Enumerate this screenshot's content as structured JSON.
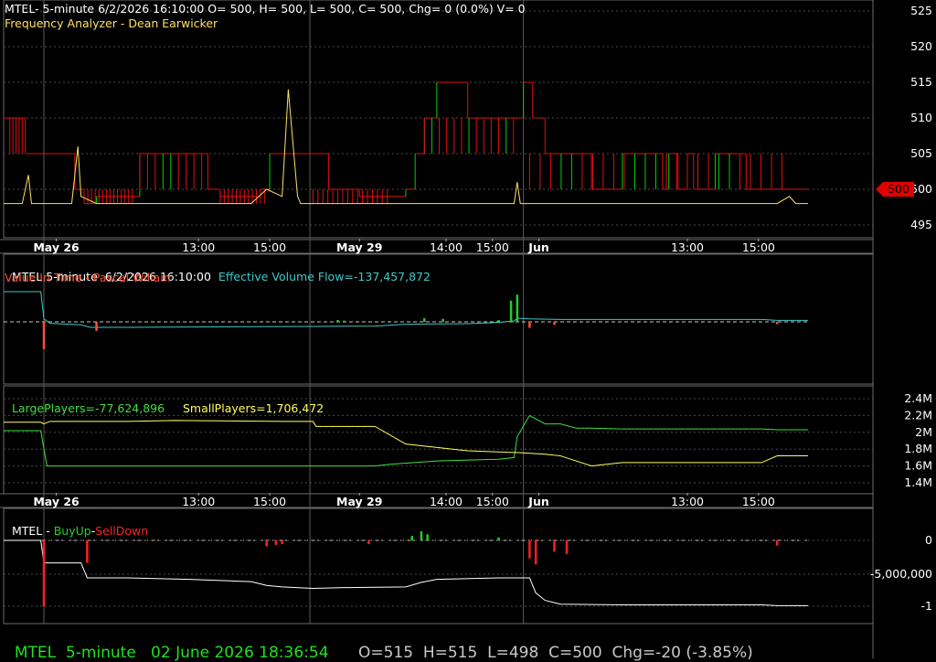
{
  "colors": {
    "bg": "#000000",
    "grid": "#4a4a4a",
    "axis_text": "#ffffff",
    "price_up": "#00d000",
    "price_down": "#e01010",
    "freq": "#ffe060",
    "evf": "#40c8c8",
    "vit": "#ff5030",
    "large": "#40e040",
    "small": "#ffff60",
    "buyup": "#20d020",
    "selldown": "#ff2020",
    "sum_line": "#ffffff",
    "status_symbol": "#20e020",
    "status_ohlc": "#c8c8c8",
    "marker_bg": "#e00000"
  },
  "panel1": {
    "header1": "MTEL- 5-minute 6/2/2026 16:10:00 O= 500, H= 500, L= 500, C= 500, Chg= 0 (0.0%) V= 0",
    "header2": "Frequency Analyzer - Dean Earwicker",
    "yticks": [
      "525",
      "520",
      "515",
      "510",
      "505",
      "500",
      "495"
    ],
    "last_price_marker": "500"
  },
  "panel2": {
    "header_symbol": "MTEL 5-minute  6/2/2026 16:10:00",
    "header_evf": "Effective Volume Flow=-137,457,872",
    "header_vit": "Value In Time - Pascal Willain"
  },
  "panel3": {
    "header_large": "LargePlayers=-77,624,896",
    "header_small": "SmallPlayers=1,706,472",
    "yticks": [
      "2.4M",
      "2.2M",
      "2M",
      "1.8M",
      "1.6M",
      "1.4M"
    ]
  },
  "panel4": {
    "header_symbol": "MTEL - ",
    "header_buy": "BuyUp",
    "header_dash": "-",
    "header_sell": "SellDown",
    "yticks": [
      "0",
      "-5,000,000",
      "-1"
    ]
  },
  "xaxis": {
    "labels": [
      "May 26",
      "13:00",
      "15:00",
      "May 29",
      "14:00",
      "15:00",
      "Jun",
      "13:00",
      "15:00"
    ]
  },
  "status": {
    "symbol": "MTEL",
    "interval": "5-minute",
    "datetime": "02 June 2026 18:36:54",
    "open": "O=515",
    "high": "H=515",
    "low": "L=498",
    "close": "C=500",
    "change": "Chg=-20 (-3.85%)"
  },
  "chart_data": [
    {
      "type": "line",
      "title": "MTEL- 5-minute 6/2/2026 16:10:00 O= 500, H= 500, L= 500, C= 500, Chg= 0 (0.0%) V= 0",
      "ylim": [
        493,
        526
      ],
      "x_labels": [
        "May 26",
        "13:00",
        "15:00",
        "May 29",
        "14:00",
        "15:00",
        "Jun",
        "13:00",
        "15:00"
      ],
      "series": [
        {
          "name": "",
          "x": [
            0,
            6,
            7,
            20,
            23,
            26,
            30,
            42,
            44,
            50,
            63,
            66,
            70,
            80,
            83,
            86,
            90,
            100,
            105,
            115,
            125,
            130,
            133,
            136,
            140,
            150,
            160,
            168,
            171,
            175,
            180,
            190,
            200,
            210,
            213,
            215,
            218,
            221,
            223,
            230,
            240,
            260
          ],
          "values": [
            510,
            510,
            505,
            505,
            500,
            498,
            499,
            499,
            505,
            505,
            505,
            500,
            499,
            499,
            500,
            505,
            505,
            505,
            500,
            499,
            499,
            500,
            505,
            510,
            515,
            510,
            510,
            515,
            510,
            505,
            505,
            500,
            505,
            505,
            500,
            505,
            500,
            505,
            500,
            505,
            500,
            500
          ]
        },
        {
          "name": "Frequency Analyzer",
          "x": [
            0,
            6,
            8,
            9,
            10,
            15,
            22,
            24,
            25,
            30,
            50,
            70,
            75,
            80,
            85,
            90,
            92,
            95,
            96,
            97,
            98,
            100,
            125,
            150,
            165,
            166,
            167,
            170,
            180,
            200,
            220,
            250,
            254,
            256,
            260
          ],
          "values": [
            498,
            498,
            502,
            498,
            498,
            498,
            498,
            506,
            499,
            498,
            498,
            498,
            498,
            498,
            500,
            499,
            514,
            499,
            498,
            498,
            498,
            498,
            498,
            498,
            498,
            501,
            498,
            498,
            498,
            498,
            498,
            498,
            499,
            498,
            498
          ]
        }
      ]
    },
    {
      "type": "line",
      "title": "Effective Volume Flow=-137,457,872",
      "series": [
        {
          "name": "Effective Volume Flow",
          "x": [
            0,
            12,
            13,
            15,
            25,
            28,
            40,
            60,
            80,
            100,
            120,
            125,
            130,
            140,
            150,
            160,
            165,
            166,
            170,
            180,
            200,
            220,
            245,
            250,
            260
          ],
          "values": [
            10,
            10,
            1,
            -0.5,
            -1,
            -1.8,
            -1.8,
            -1.7,
            -1.6,
            -1.5,
            -1.4,
            -1.1,
            -0.8,
            -0.7,
            -0.6,
            -0.2,
            0.3,
            1.2,
            1.0,
            0.8,
            0.8,
            0.8,
            0.8,
            0.5,
            0.5
          ]
        }
      ]
    },
    {
      "type": "line",
      "title": "LargePlayers / SmallPlayers",
      "ylim": [
        1.3,
        2.5
      ],
      "series": [
        {
          "name": "LargePlayers",
          "x": [
            0,
            12,
            13,
            14,
            50,
            90,
            110,
            120,
            125,
            140,
            160,
            165,
            166,
            170,
            175,
            180,
            185,
            190,
            200,
            220,
            245,
            250,
            260
          ],
          "values": [
            2.02,
            2.02,
            1.8,
            1.6,
            1.6,
            1.6,
            1.6,
            1.6,
            1.62,
            1.66,
            1.68,
            1.7,
            1.95,
            2.2,
            2.1,
            2.1,
            2.05,
            2.05,
            2.04,
            2.04,
            2.04,
            2.03,
            2.03
          ]
        },
        {
          "name": "SmallPlayers",
          "x": [
            0,
            12,
            13,
            15,
            40,
            55,
            90,
            100,
            101,
            120,
            130,
            150,
            165,
            166,
            175,
            180,
            185,
            190,
            200,
            220,
            245,
            250,
            260
          ],
          "values": [
            2.12,
            2.12,
            2.1,
            2.13,
            2.13,
            2.14,
            2.13,
            2.13,
            2.07,
            2.07,
            1.86,
            1.78,
            1.76,
            1.76,
            1.74,
            1.72,
            1.66,
            1.6,
            1.64,
            1.64,
            1.64,
            1.72,
            1.72
          ]
        }
      ]
    },
    {
      "type": "line",
      "title": "MTEL - BuyUp-SellDown",
      "series": [
        {
          "name": "BuyUp-SellDown",
          "x": [
            0,
            12,
            13,
            14,
            25,
            27,
            40,
            60,
            80,
            85,
            90,
            100,
            110,
            130,
            135,
            140,
            160,
            170,
            172,
            175,
            180,
            200,
            220,
            245,
            250,
            260
          ],
          "values": [
            0,
            0,
            -3,
            -3,
            -3,
            -5,
            -5,
            -5.2,
            -5.5,
            -6,
            -6.2,
            -6.4,
            -6.3,
            -6.2,
            -5.6,
            -5.2,
            -5,
            -5,
            -7,
            -8,
            -8.5,
            -8.6,
            -8.6,
            -8.6,
            -8.7,
            -8.7
          ]
        }
      ]
    }
  ]
}
